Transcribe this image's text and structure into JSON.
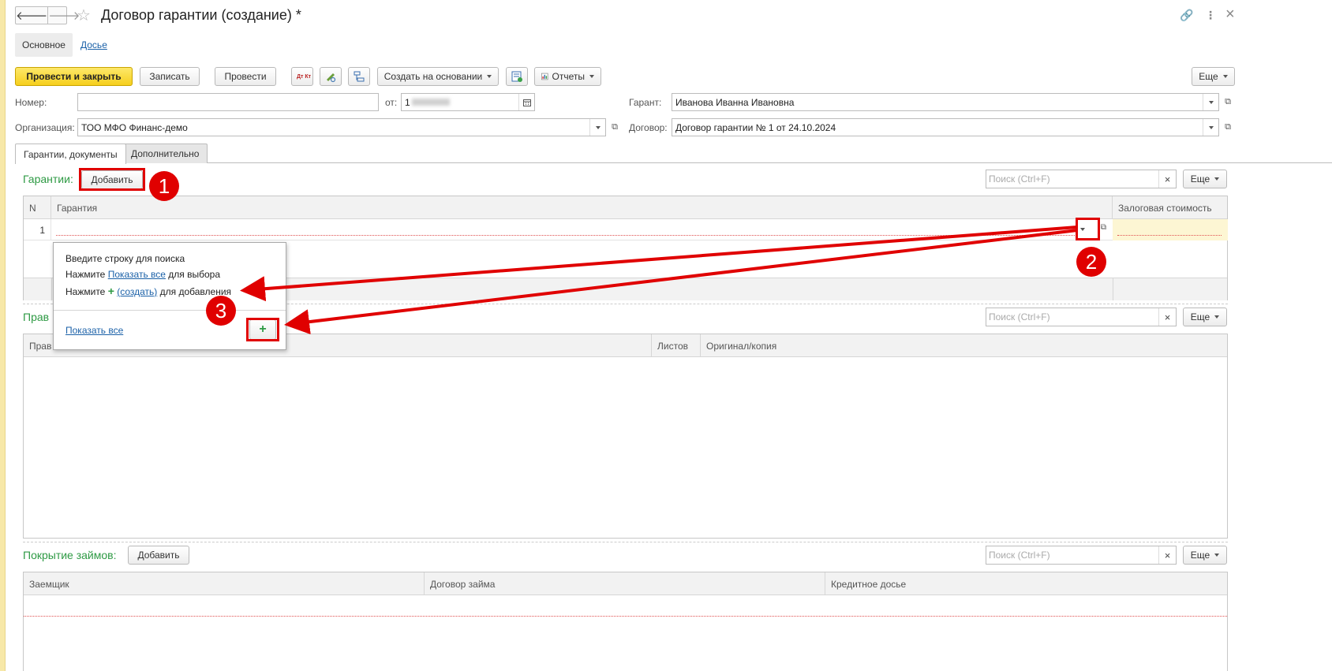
{
  "window": {
    "title": "Договор гарантии (создание) *",
    "nav_back": "🡐",
    "nav_forward": "🡒",
    "star_icon": "☆",
    "link_icon": "🔗",
    "menu_icon": "⋮",
    "close_icon": "×"
  },
  "panel_tabs": {
    "main": "Основное",
    "dossier": "Досье"
  },
  "toolbar": {
    "post_and_close": "Провести и закрыть",
    "save": "Записать",
    "post": "Провести",
    "dt_kt": "Дт Кт",
    "create_based_on": "Создать на основании",
    "reports": "Отчеты",
    "more": "Еще"
  },
  "fields": {
    "number_label": "Номер:",
    "number_value": "",
    "date_label": "от:",
    "date_value": "1",
    "guarantor_label": "Гарант:",
    "guarantor_value": "Иванова Иванна Ивановна",
    "organization_label": "Организация:",
    "organization_value": "ТОО МФО Финанс-демо",
    "contract_label": "Договор:",
    "contract_value": "Договор гарантии № 1 от 24.10.2024"
  },
  "form_tabs": {
    "guarantees_docs": "Гарантии, документы",
    "additional": "Дополнительно"
  },
  "guarantees": {
    "title": "Гарантии:",
    "add_button": "Добавить",
    "search_placeholder": "Поиск (Ctrl+F)",
    "more": "Еще",
    "columns": {
      "n": "N",
      "guarantee": "Гарантия",
      "collateral_value": "Залоговая стоимость"
    },
    "rows": [
      {
        "n": "1",
        "guarantee": "",
        "collateral_value": ""
      }
    ]
  },
  "popup": {
    "line1": "Введите строку для поиска",
    "line2_pre": "Нажмите ",
    "line2_link": "Показать все",
    "line2_post": " для выбора",
    "line3_pre": "Нажмите ",
    "line3_link": "(создать)",
    "line3_post": " для добавления",
    "show_all": "Показать все",
    "plus": "+"
  },
  "rights": {
    "title": "Прав",
    "search_placeholder": "Поиск (Ctrl+F)",
    "more": "Еще",
    "columns": {
      "name": "Прав",
      "sheets": "Листов",
      "original_copy": "Оригинал/копия"
    }
  },
  "loans": {
    "title": "Покрытие займов:",
    "add_button": "Добавить",
    "search_placeholder": "Поиск (Ctrl+F)",
    "more": "Еще",
    "columns": {
      "borrower": "Заемщик",
      "loan_contract": "Договор займа",
      "credit_dossier": "Кредитное досье"
    }
  },
  "annotations": {
    "badge1": "1",
    "badge2": "2",
    "badge3": "3",
    "color": "#e00000"
  }
}
